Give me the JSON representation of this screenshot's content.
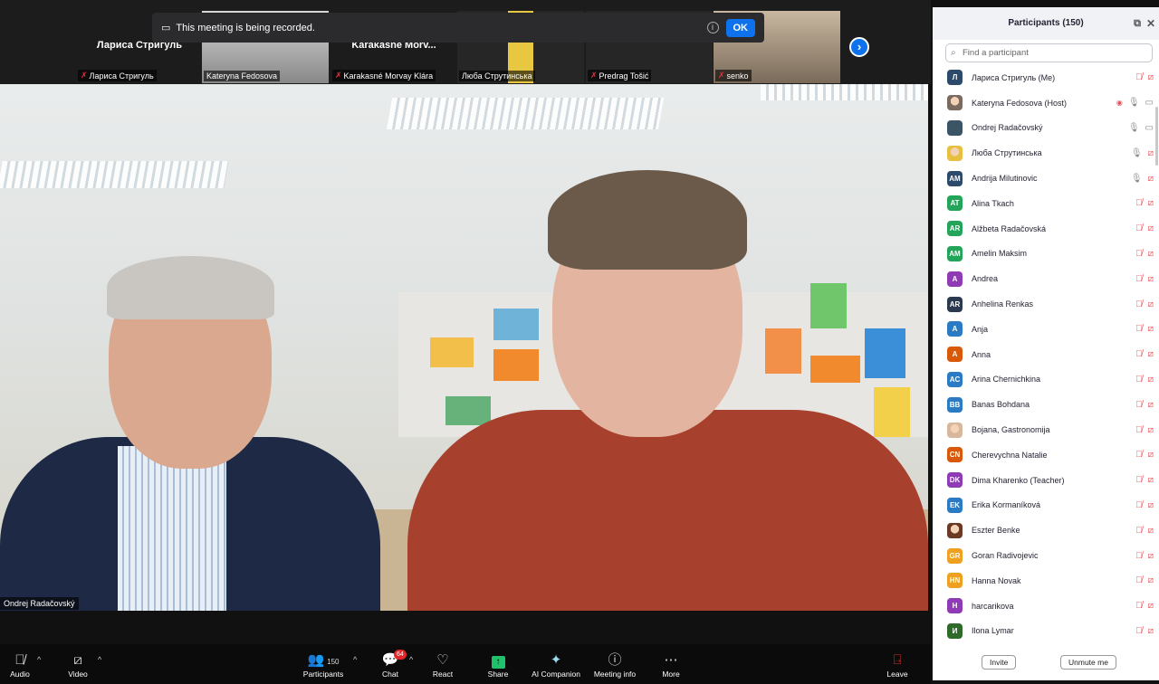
{
  "banner": {
    "text": "This meeting is being recorded.",
    "ok": "OK"
  },
  "thumbnails": [
    {
      "big_name": "Лариса Стригуль",
      "label": "Лариса Стригуль",
      "muted": true
    },
    {
      "big_name": "",
      "label": "Kateryna Fedosova",
      "muted": false
    },
    {
      "big_name": "Karakasné  Morv...",
      "label": "Karakasné Morvay Klára",
      "muted": true
    },
    {
      "big_name": "",
      "label": "Люба Струтинська",
      "muted": false
    },
    {
      "big_name": "",
      "label": "Predrag Tošić",
      "muted": true
    },
    {
      "big_name": "",
      "label": "senko",
      "muted": true
    }
  ],
  "video": {
    "speaker_label": "Ondrej Radačovský"
  },
  "toolbar": {
    "audio": "Audio",
    "video": "Video",
    "participants": "Participants",
    "participants_count": "150",
    "chat": "Chat",
    "chat_badge": "64",
    "react": "React",
    "share": "Share",
    "ai": "AI Companion",
    "info": "Meeting info",
    "more": "More",
    "leave": "Leave"
  },
  "panel": {
    "title": "Participants (150)",
    "search_placeholder": "Find a participant",
    "invite": "Invite",
    "unmute": "Unmute me"
  },
  "participants": [
    {
      "name": "Лариса Стригуль (Me)",
      "initials": "Л",
      "color": "#2d4a6b",
      "mic": "muted",
      "cam": "off"
    },
    {
      "name": "Kateryna Fedosova (Host)",
      "initials": "",
      "color": "#7a6a60",
      "photo": true,
      "rec": true,
      "mic": "on",
      "cam": "on"
    },
    {
      "name": "Ondrej Radačovský",
      "initials": "",
      "color": "#3c5566",
      "mic": "on",
      "cam": "on"
    },
    {
      "name": "Люба Струтинська",
      "initials": "",
      "color": "#e8c040",
      "photo": true,
      "mic": "on",
      "cam": "off"
    },
    {
      "name": "Andrija Milutinovic",
      "initials": "AM",
      "color": "#2d4a6b",
      "mic": "on",
      "cam": "off"
    },
    {
      "name": "Alina Tkach",
      "initials": "AT",
      "color": "#23a559",
      "mic": "muted",
      "cam": "off"
    },
    {
      "name": "Alžbeta Radačovská",
      "initials": "AR",
      "color": "#23a559",
      "mic": "muted",
      "cam": "off"
    },
    {
      "name": "Amelin Maksim",
      "initials": "AM",
      "color": "#23a559",
      "mic": "muted",
      "cam": "off"
    },
    {
      "name": "Andrea",
      "initials": "A",
      "color": "#8e3bb5",
      "mic": "muted",
      "cam": "off"
    },
    {
      "name": "Anhelina Renkas",
      "initials": "AR",
      "color": "#2b3a4f",
      "mic": "muted",
      "cam": "off"
    },
    {
      "name": "Anja",
      "initials": "A",
      "color": "#2a7bc4",
      "mic": "muted",
      "cam": "off"
    },
    {
      "name": "Anna",
      "initials": "A",
      "color": "#d9590b",
      "mic": "muted",
      "cam": "off"
    },
    {
      "name": "Arina Chernichkina",
      "initials": "AC",
      "color": "#2a7bc4",
      "mic": "muted",
      "cam": "off"
    },
    {
      "name": "Banas Bohdana",
      "initials": "BB",
      "color": "#2a7bc4",
      "mic": "muted",
      "cam": "off"
    },
    {
      "name": "Bojana, Gastronomija",
      "initials": "",
      "color": "#d8b89a",
      "photo": true,
      "mic": "muted",
      "cam": "off"
    },
    {
      "name": "Cherevychna Natalie",
      "initials": "CN",
      "color": "#d9590b",
      "mic": "muted",
      "cam": "off"
    },
    {
      "name": "Dima Kharenko (Teacher)",
      "initials": "DK",
      "color": "#8e3bb5",
      "mic": "muted",
      "cam": "off"
    },
    {
      "name": "Erika Kormaníková",
      "initials": "EK",
      "color": "#2a7bc4",
      "mic": "muted",
      "cam": "off"
    },
    {
      "name": "Eszter Benke",
      "initials": "",
      "color": "#6b3a22",
      "photo": true,
      "mic": "muted",
      "cam": "off"
    },
    {
      "name": "Goran Radivojevic",
      "initials": "GR",
      "color": "#f0a020",
      "mic": "muted",
      "cam": "off"
    },
    {
      "name": "Hanna Novak",
      "initials": "HN",
      "color": "#f0a020",
      "mic": "muted",
      "cam": "off"
    },
    {
      "name": "harcarikova",
      "initials": "H",
      "color": "#8e3bb5",
      "mic": "muted",
      "cam": "off"
    },
    {
      "name": "Ilona Lymar",
      "initials": "И",
      "color": "#2e6b2a",
      "mic": "muted",
      "cam": "off"
    }
  ]
}
